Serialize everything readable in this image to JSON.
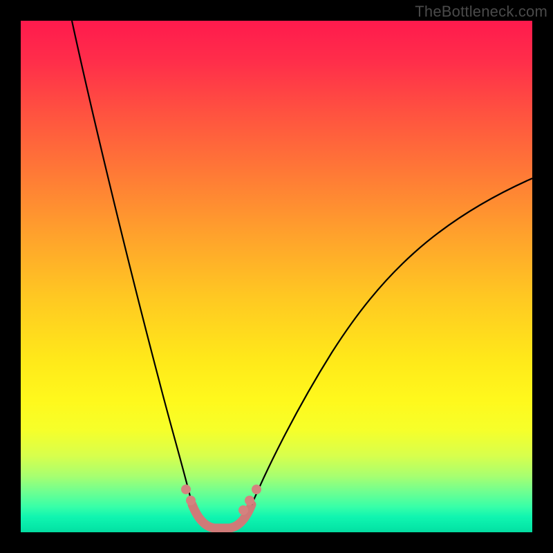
{
  "watermark": {
    "text": "TheBottleneck.com"
  },
  "chart_data": {
    "type": "line",
    "title": "",
    "xlabel": "",
    "ylabel": "",
    "xlim": [
      0,
      100
    ],
    "ylim": [
      0,
      100
    ],
    "grid": false,
    "legend": false,
    "background": {
      "type": "vertical-gradient",
      "stops": [
        {
          "pos": 0,
          "color": "#ff1a4d"
        },
        {
          "pos": 18,
          "color": "#ff5240"
        },
        {
          "pos": 42,
          "color": "#ffa22c"
        },
        {
          "pos": 66,
          "color": "#ffe81a"
        },
        {
          "pos": 85,
          "color": "#d8ff4c"
        },
        {
          "pos": 95,
          "color": "#38ffa8"
        },
        {
          "pos": 100,
          "color": "#04dca0"
        }
      ]
    },
    "series": [
      {
        "name": "left-arm",
        "stroke": "#000000",
        "x": [
          10.0,
          12.0,
          14.0,
          16.0,
          18.0,
          20.0,
          22.0,
          24.0,
          26.0,
          28.0,
          30.0,
          31.5,
          33.0
        ],
        "y": [
          100.0,
          88.0,
          76.5,
          66.0,
          56.0,
          46.5,
          38.0,
          30.0,
          23.0,
          16.5,
          11.0,
          7.5,
          5.0
        ]
      },
      {
        "name": "trough",
        "stroke": "#cf7a78",
        "stroke_width": 7,
        "x": [
          33.0,
          34.0,
          36.0,
          38.0,
          40.0,
          42.0,
          43.5,
          45.0
        ],
        "y": [
          5.0,
          3.0,
          1.5,
          1.0,
          1.0,
          1.5,
          3.0,
          5.0
        ]
      },
      {
        "name": "right-arm",
        "stroke": "#000000",
        "x": [
          45.0,
          48.0,
          52.0,
          56.0,
          60.0,
          65.0,
          70.0,
          75.0,
          80.0,
          85.0,
          90.0,
          95.0,
          100.0
        ],
        "y": [
          5.0,
          9.0,
          15.0,
          21.0,
          27.0,
          34.0,
          40.5,
          46.5,
          52.0,
          57.0,
          61.5,
          65.5,
          69.0
        ]
      }
    ],
    "markers": [
      {
        "x": 32.0,
        "y": 8.0,
        "r": 5,
        "color": "#d4827f"
      },
      {
        "x": 33.0,
        "y": 6.0,
        "r": 5,
        "color": "#d4827f"
      },
      {
        "x": 43.0,
        "y": 4.5,
        "r": 5,
        "color": "#d4827f"
      },
      {
        "x": 44.5,
        "y": 6.5,
        "r": 5,
        "color": "#d4827f"
      },
      {
        "x": 46.0,
        "y": 8.5,
        "r": 5,
        "color": "#d4827f"
      }
    ]
  }
}
